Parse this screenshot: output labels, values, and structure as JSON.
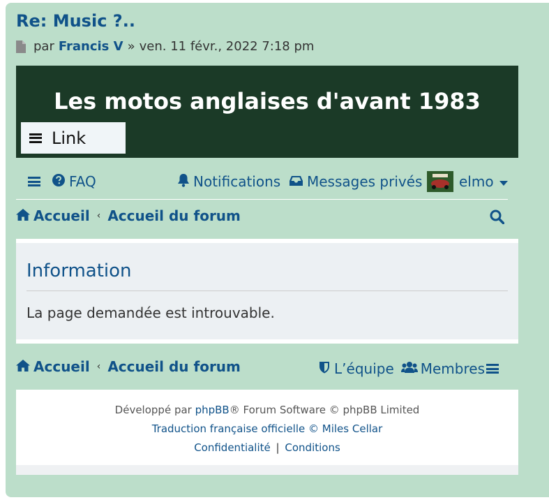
{
  "post": {
    "title": "Re: Music ?..",
    "by_label": "par",
    "author": "Francis V",
    "separator": "»",
    "date": "ven. 11 févr., 2022 7:18 pm"
  },
  "banner": {
    "title": "Les motos anglaises d'avant 1983",
    "link_label": "Link"
  },
  "navbar": {
    "faq": "FAQ",
    "notifications": "Notifications",
    "messages": "Messages privés",
    "username": "elmo"
  },
  "breadcrumbs": {
    "home": "Accueil",
    "forum": "Accueil du forum",
    "arrow": "‹"
  },
  "info": {
    "heading": "Information",
    "message": "La page demandée est introuvable."
  },
  "footer": {
    "team": "L’équipe",
    "members": "Membres",
    "line1_pre": "Développé par ",
    "line1_link": "phpBB",
    "line1_post": "® Forum Software © phpBB Limited",
    "line2": "Traduction française officielle © Miles Cellar",
    "privacy": "Confidentialité",
    "pipe": "|",
    "terms": "Conditions"
  },
  "colors": {
    "page_bg": "#bcdeca",
    "link": "#105289",
    "banner_bg": "#1b3a27",
    "panel_bg": "#ecf0f3"
  }
}
